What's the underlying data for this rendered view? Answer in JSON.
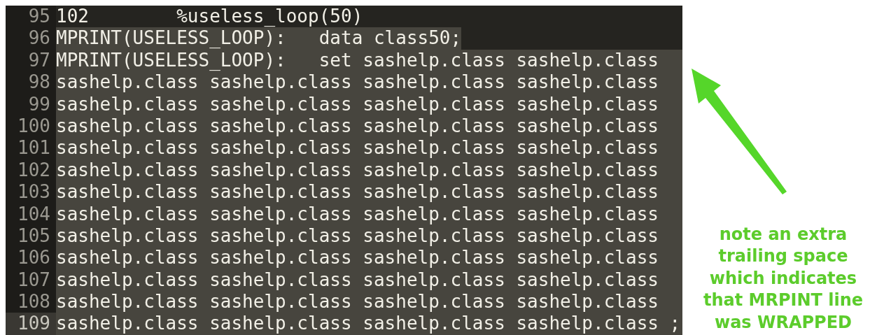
{
  "editor": {
    "lines": [
      {
        "number": "95",
        "text": "102        %useless_loop(50)",
        "selected": false,
        "selected_to_edge": false,
        "current": false
      },
      {
        "number": "96",
        "text": "MPRINT(USELESS_LOOP):   data class50;",
        "selected": true,
        "selected_to_edge": false,
        "current": false
      },
      {
        "number": "97",
        "text": "MPRINT(USELESS_LOOP):   set sashelp.class sashelp.class ",
        "selected": true,
        "selected_to_edge": true,
        "current": false
      },
      {
        "number": "98",
        "text": "sashelp.class sashelp.class sashelp.class sashelp.class ",
        "selected": true,
        "selected_to_edge": true,
        "current": false
      },
      {
        "number": "99",
        "text": "sashelp.class sashelp.class sashelp.class sashelp.class ",
        "selected": true,
        "selected_to_edge": true,
        "current": false
      },
      {
        "number": "100",
        "text": "sashelp.class sashelp.class sashelp.class sashelp.class ",
        "selected": true,
        "selected_to_edge": true,
        "current": false
      },
      {
        "number": "101",
        "text": "sashelp.class sashelp.class sashelp.class sashelp.class ",
        "selected": true,
        "selected_to_edge": true,
        "current": false
      },
      {
        "number": "102",
        "text": "sashelp.class sashelp.class sashelp.class sashelp.class ",
        "selected": true,
        "selected_to_edge": true,
        "current": false
      },
      {
        "number": "103",
        "text": "sashelp.class sashelp.class sashelp.class sashelp.class ",
        "selected": true,
        "selected_to_edge": true,
        "current": false
      },
      {
        "number": "104",
        "text": "sashelp.class sashelp.class sashelp.class sashelp.class ",
        "selected": true,
        "selected_to_edge": true,
        "current": false
      },
      {
        "number": "105",
        "text": "sashelp.class sashelp.class sashelp.class sashelp.class ",
        "selected": true,
        "selected_to_edge": true,
        "current": false
      },
      {
        "number": "106",
        "text": "sashelp.class sashelp.class sashelp.class sashelp.class ",
        "selected": true,
        "selected_to_edge": true,
        "current": false
      },
      {
        "number": "107",
        "text": "sashelp.class sashelp.class sashelp.class sashelp.class ",
        "selected": true,
        "selected_to_edge": true,
        "current": false
      },
      {
        "number": "108",
        "text": "sashelp.class sashelp.class sashelp.class sashelp.class ",
        "selected": true,
        "selected_to_edge": true,
        "current": false
      },
      {
        "number": "109",
        "text": "sashelp.class sashelp.class sashelp.class sashelp.class ;",
        "selected": true,
        "selected_to_edge": true,
        "current": true
      }
    ]
  },
  "annotation": {
    "text": "note an extra trailing space which indicates that MRPINT line was WRAPPED"
  }
}
